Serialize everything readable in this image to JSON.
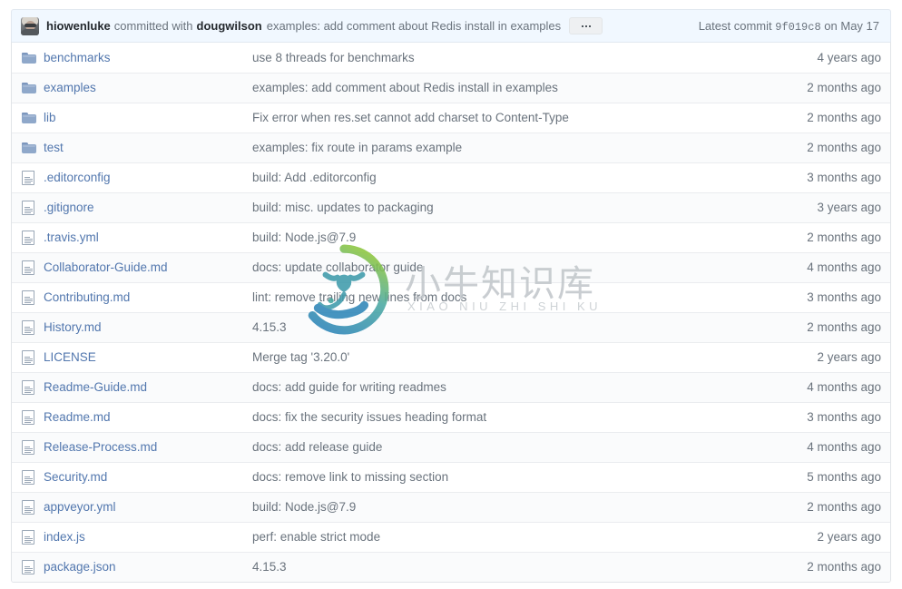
{
  "commit_header": {
    "avatar_name": "user-avatar",
    "author": "hiowenluke",
    "committed_with_text": "committed with",
    "coauthor": "dougwilson",
    "message": "examples: add comment about Redis install in examples",
    "more_button_label": "…",
    "latest_commit_label": "Latest commit",
    "commit_sha": "9f019c8",
    "commit_date": "on May 17"
  },
  "files": [
    {
      "type": "folder",
      "name": "benchmarks",
      "message": "use 8 threads for benchmarks",
      "age": "4 years ago"
    },
    {
      "type": "folder",
      "name": "examples",
      "message": "examples: add comment about Redis install in examples",
      "age": "2 months ago"
    },
    {
      "type": "folder",
      "name": "lib",
      "message": "Fix error when res.set cannot add charset to Content-Type",
      "age": "2 months ago"
    },
    {
      "type": "folder",
      "name": "test",
      "message": "examples: fix route in params example",
      "age": "2 months ago"
    },
    {
      "type": "file",
      "name": ".editorconfig",
      "message": "build: Add .editorconfig",
      "age": "3 months ago"
    },
    {
      "type": "file",
      "name": ".gitignore",
      "message": "build: misc. updates to packaging",
      "age": "3 years ago"
    },
    {
      "type": "file",
      "name": ".travis.yml",
      "message": "build: Node.js@7.9",
      "age": "2 months ago"
    },
    {
      "type": "file",
      "name": "Collaborator-Guide.md",
      "message": "docs: update collaborator guide",
      "age": "4 months ago"
    },
    {
      "type": "file",
      "name": "Contributing.md",
      "message": "lint: remove trailing new lines from docs",
      "age": "3 months ago"
    },
    {
      "type": "file",
      "name": "History.md",
      "message": "4.15.3",
      "age": "2 months ago"
    },
    {
      "type": "file",
      "name": "LICENSE",
      "message": "Merge tag '3.20.0'",
      "age": "2 years ago"
    },
    {
      "type": "file",
      "name": "Readme-Guide.md",
      "message": "docs: add guide for writing readmes",
      "age": "4 months ago"
    },
    {
      "type": "file",
      "name": "Readme.md",
      "message": "docs: fix the security issues heading format",
      "age": "3 months ago"
    },
    {
      "type": "file",
      "name": "Release-Process.md",
      "message": "docs: add release guide",
      "age": "4 months ago"
    },
    {
      "type": "file",
      "name": "Security.md",
      "message": "docs: remove link to missing section",
      "age": "5 months ago"
    },
    {
      "type": "file",
      "name": "appveyor.yml",
      "message": "build: Node.js@7.9",
      "age": "2 months ago"
    },
    {
      "type": "file",
      "name": "index.js",
      "message": "perf: enable strict mode",
      "age": "2 years ago"
    },
    {
      "type": "file",
      "name": "package.json",
      "message": "4.15.3",
      "age": "2 months ago"
    }
  ],
  "watermark": {
    "chinese_text": "小牛知识库",
    "pinyin_text": "XIAO NIU ZHI SHI KU",
    "logo_gradient_start": "#86c24a",
    "logo_gradient_end": "#2f86b5",
    "text_color": "#c2c7cb"
  },
  "colors": {
    "link": "#5277ae",
    "muted_text": "#6a737d",
    "header_bg": "#f1f8ff",
    "row_alt_bg": "#fafbfc",
    "border": "#e1e4e8",
    "folder_icon": "#8fa8ca"
  }
}
